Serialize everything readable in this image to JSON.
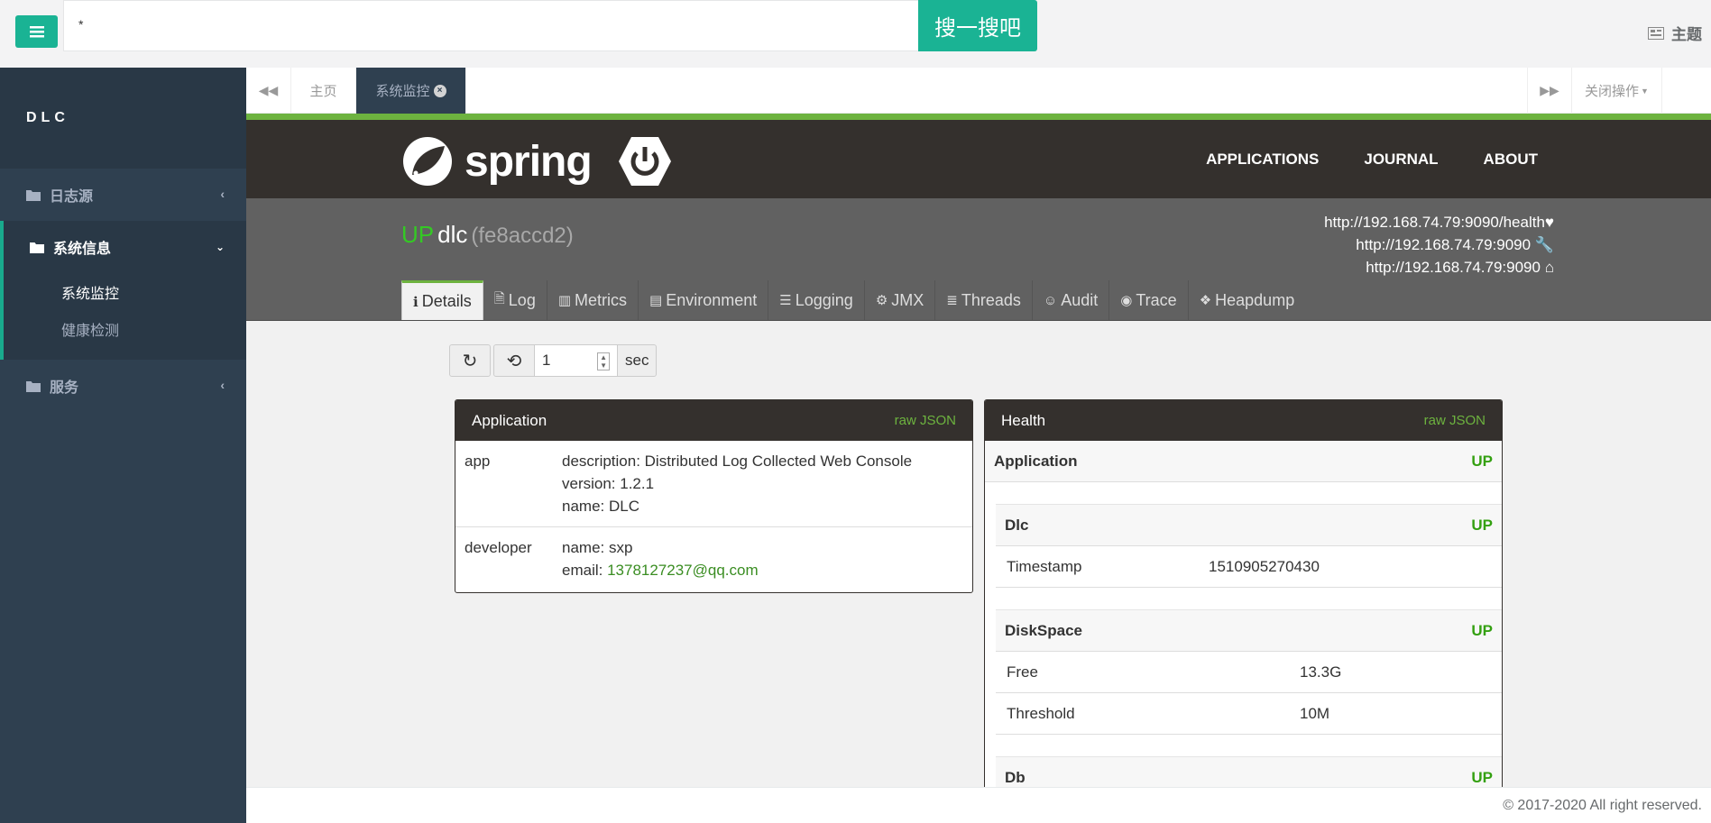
{
  "topbar": {
    "search_value": "*",
    "search_button": "搜一搜吧",
    "theme_label": "主题",
    "colors": {
      "accent": "#1ab394"
    }
  },
  "sidebar": {
    "brand": "DLC",
    "items": [
      {
        "label": "日志源",
        "icon": "folder-icon"
      },
      {
        "label": "系统信息",
        "icon": "folder-icon",
        "expanded": true,
        "children": [
          {
            "label": "系统监控"
          },
          {
            "label": "健康检测"
          }
        ]
      },
      {
        "label": "服务",
        "icon": "folder-icon"
      }
    ]
  },
  "tabsbar": {
    "home_tab": "主页",
    "active_tab": "系统监控",
    "close_ops": "关闭操作"
  },
  "spring": {
    "logo_text": "spring",
    "nav": [
      "APPLICATIONS",
      "JOURNAL",
      "ABOUT"
    ],
    "colors": {
      "green": "#6db33f",
      "dark": "#34302d"
    }
  },
  "app": {
    "status": "UP",
    "name": "dlc",
    "id": "(fe8accd2)",
    "urls": [
      "http://192.168.74.79:9090/health",
      "http://192.168.74.79:9090",
      "http://192.168.74.79:9090"
    ],
    "tabs": [
      "Details",
      "Log",
      "Metrics",
      "Environment",
      "Logging",
      "JMX",
      "Threads",
      "Audit",
      "Trace",
      "Heapdump"
    ]
  },
  "controls": {
    "interval_value": "1",
    "unit": "sec"
  },
  "application_panel": {
    "title": "Application",
    "raw_json": "raw JSON",
    "rows": [
      {
        "key": "app",
        "lines": [
          "description: Distributed Log Collected Web Console",
          "version: 1.2.1",
          "name: DLC"
        ]
      },
      {
        "key": "developer",
        "name_line": "name: sxp",
        "email_label": "email: ",
        "email": "1378127237@qq.com"
      }
    ]
  },
  "health_panel": {
    "title": "Health",
    "raw_json": "raw JSON",
    "application_label": "Application",
    "application_status": "UP",
    "groups": [
      {
        "name": "Dlc",
        "status": "UP",
        "rows": [
          {
            "k": "Timestamp",
            "v": "1510905270430"
          }
        ]
      },
      {
        "name": "DiskSpace",
        "status": "UP",
        "rows": [
          {
            "k": "Free",
            "v": "13.3G"
          },
          {
            "k": "Threshold",
            "v": "10M"
          }
        ]
      },
      {
        "name": "Db",
        "status": "UP",
        "rows": []
      }
    ]
  },
  "footer": {
    "text": "© 2017-2020 All right reserved."
  }
}
